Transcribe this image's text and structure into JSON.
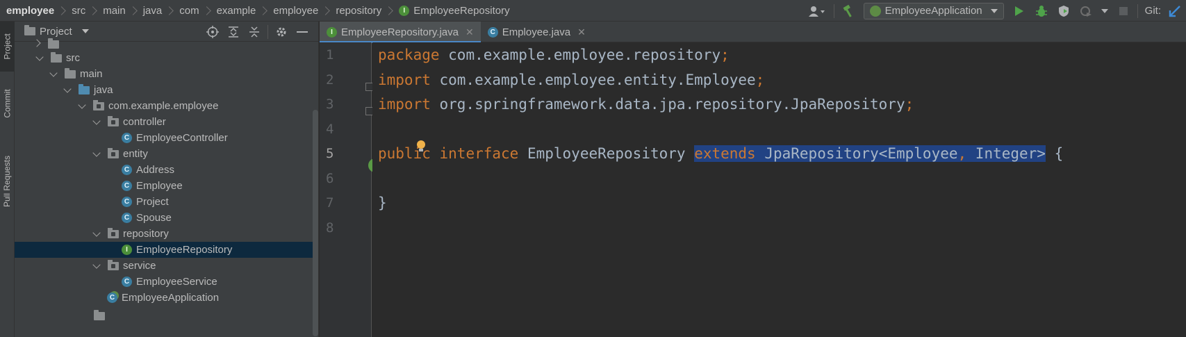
{
  "breadcrumb": [
    "employee",
    "src",
    "main",
    "java",
    "com",
    "example",
    "employee",
    "repository",
    "EmployeeRepository"
  ],
  "toolbar": {
    "run_config": "EmployeeApplication",
    "git_label": "Git:"
  },
  "stripe": {
    "project": "Project",
    "commit": "Commit",
    "pull_requests": "Pull Requests"
  },
  "project_panel": {
    "title": "Project",
    "tree": [
      {
        "label": "src",
        "icon": "folder"
      },
      {
        "label": "main",
        "icon": "folder"
      },
      {
        "label": "java",
        "icon": "source-folder"
      },
      {
        "label": "com.example.employee",
        "icon": "package"
      },
      {
        "label": "controller",
        "icon": "package"
      },
      {
        "label": "EmployeeController",
        "icon": "class"
      },
      {
        "label": "entity",
        "icon": "package"
      },
      {
        "label": "Address",
        "icon": "class"
      },
      {
        "label": "Employee",
        "icon": "class"
      },
      {
        "label": "Project",
        "icon": "class"
      },
      {
        "label": "Spouse",
        "icon": "class"
      },
      {
        "label": "repository",
        "icon": "package"
      },
      {
        "label": "EmployeeRepository",
        "icon": "interface",
        "selected": true
      },
      {
        "label": "service",
        "icon": "package"
      },
      {
        "label": "EmployeeService",
        "icon": "class"
      },
      {
        "label": "EmployeeApplication",
        "icon": "spring-app"
      }
    ]
  },
  "editor": {
    "tabs": [
      {
        "label": "EmployeeRepository.java",
        "active": true
      },
      {
        "label": "Employee.java",
        "active": false
      }
    ],
    "line_numbers": [
      "1",
      "2",
      "3",
      "4",
      "5",
      "6",
      "7",
      "8"
    ],
    "code": {
      "l1_kw": "package",
      "l1_rest": " com.example.employee.repository",
      "l1_semi": ";",
      "l2_kw": "import",
      "l2_rest": " com.example.employee.entity.Employee",
      "l2_semi": ";",
      "l3_kw": "import",
      "l3_rest": " org.springframework.data.jpa.repository.JpaRepository",
      "l3_semi": ";",
      "l5_public": "public",
      "l5_interface": "interface",
      "l5_name": " EmployeeRepository ",
      "l5_extends": "extends",
      "l5_type": " JpaRepository<Employee",
      "l5_comma": ",",
      "l5_type2": " Integer>",
      "l5_brace": " {",
      "l7": "}"
    }
  },
  "colors": {
    "keyword": "#cc7832",
    "text": "#a9b7c6",
    "selection": "#214283",
    "background": "#2b2b2b"
  }
}
